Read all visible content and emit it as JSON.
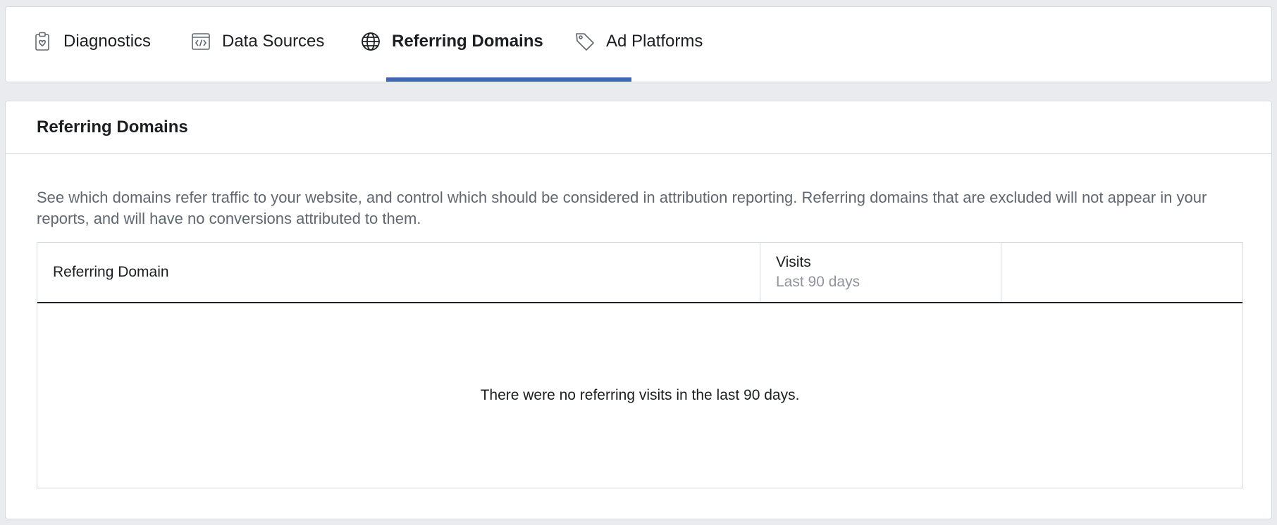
{
  "tabs": [
    {
      "label": "Diagnostics",
      "icon": "clipboard-heart-icon",
      "active": false
    },
    {
      "label": "Data Sources",
      "icon": "code-window-icon",
      "active": false
    },
    {
      "label": "Referring Domains",
      "icon": "globe-icon",
      "active": true
    },
    {
      "label": "Ad Platforms",
      "icon": "tag-icon",
      "active": false
    }
  ],
  "accent_color": "#4267b2",
  "section": {
    "title": "Referring Domains",
    "description": "See which domains refer traffic to your website, and control which should be considered in attribution reporting. Referring domains that are excluded will not appear in your reports, and will have no conversions attributed to them."
  },
  "table": {
    "columns": [
      {
        "label": "Referring Domain",
        "sublabel": ""
      },
      {
        "label": "Visits",
        "sublabel": "Last 90 days"
      },
      {
        "label": "",
        "sublabel": ""
      }
    ],
    "rows": [],
    "empty_message": "There were no referring visits in the last 90 days."
  }
}
